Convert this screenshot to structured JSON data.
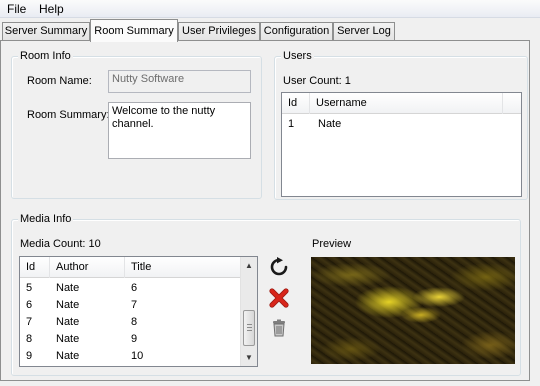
{
  "menu": {
    "items": [
      "File",
      "Help"
    ]
  },
  "tabs": [
    {
      "label": "Server Summary",
      "active": false
    },
    {
      "label": "Room Summary",
      "active": true
    },
    {
      "label": "User Privileges",
      "active": false
    },
    {
      "label": "Configuration",
      "active": false
    },
    {
      "label": "Server Log",
      "active": false
    }
  ],
  "room_info": {
    "legend": "Room Info",
    "room_name_label": "Room Name:",
    "room_name_value": "Nutty Software",
    "room_summary_label": "Room Summary:",
    "room_summary_value": "Welcome to the nutty channel."
  },
  "users": {
    "legend": "Users",
    "count_text": "User Count: 1",
    "columns": [
      "Id",
      "Username"
    ],
    "rows": [
      {
        "id": "1",
        "username": "Nate"
      }
    ]
  },
  "media_info": {
    "legend": "Media Info",
    "count_text": "Media Count: 10",
    "columns": [
      "Id",
      "Author",
      "Title"
    ],
    "rows": [
      {
        "id": "5",
        "author": "Nate",
        "title": "6"
      },
      {
        "id": "6",
        "author": "Nate",
        "title": "7"
      },
      {
        "id": "7",
        "author": "Nate",
        "title": "8"
      },
      {
        "id": "8",
        "author": "Nate",
        "title": "9"
      },
      {
        "id": "9",
        "author": "Nate",
        "title": "10"
      }
    ],
    "actions": [
      "refresh-icon",
      "delete-icon",
      "trash-icon"
    ],
    "preview_label": "Preview"
  },
  "colors": {
    "refresh": "#1a1a1a",
    "delete": "#d8261b",
    "trash": "#8a8a8a"
  }
}
